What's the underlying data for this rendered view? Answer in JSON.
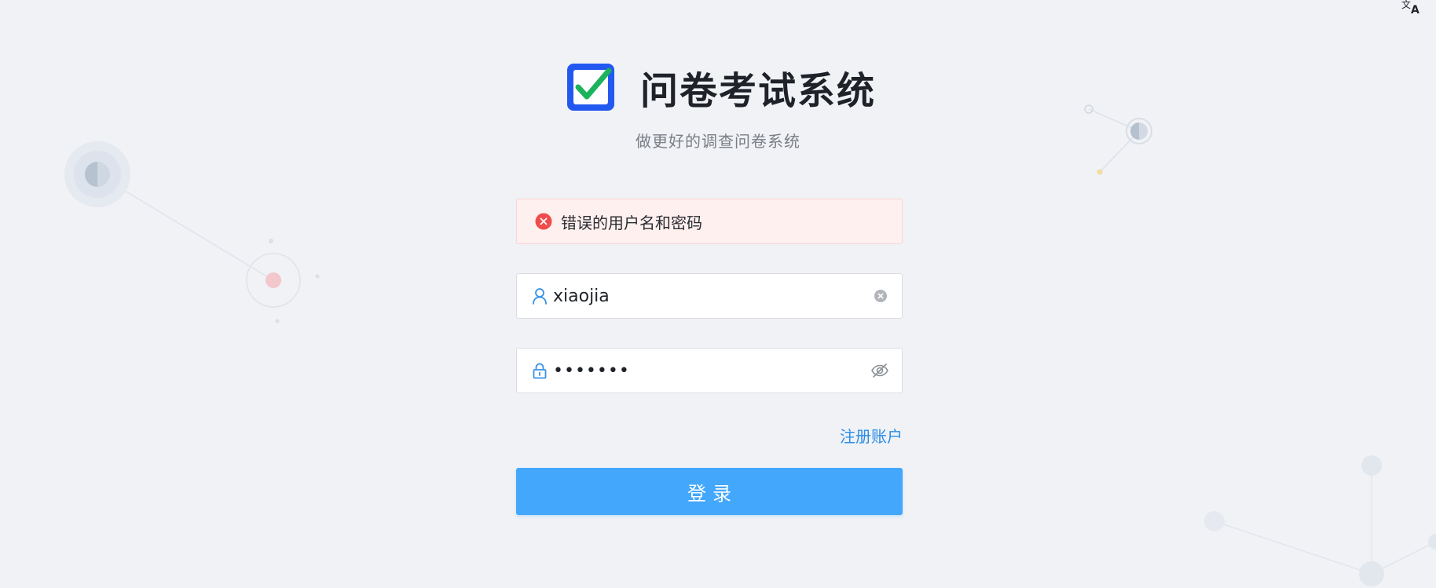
{
  "app": {
    "title": "问卷考试系统",
    "subtitle": "做更好的调查问卷系统",
    "logo_icon": "checkbox-check-icon"
  },
  "language_switch": {
    "icon": "translate-icon"
  },
  "alert": {
    "type": "error",
    "icon": "error-circle-icon",
    "message": "错误的用户名和密码"
  },
  "login_form": {
    "username": {
      "icon": "user-icon",
      "value": "xiaojia",
      "clear_icon": "clear-circle-icon"
    },
    "password": {
      "icon": "lock-icon",
      "value": "•••••••",
      "toggle_icon": "eye-hidden-icon"
    },
    "register_link": "注册账户",
    "login_button": "登录"
  },
  "colors": {
    "background": "#f0f2f6",
    "primary": "#43a7fb",
    "link": "#2a8ce6",
    "error": "#f04c4c",
    "error_bg": "#fff0f0",
    "logo_blue": "#2358f0",
    "logo_green": "#1cb35c"
  }
}
